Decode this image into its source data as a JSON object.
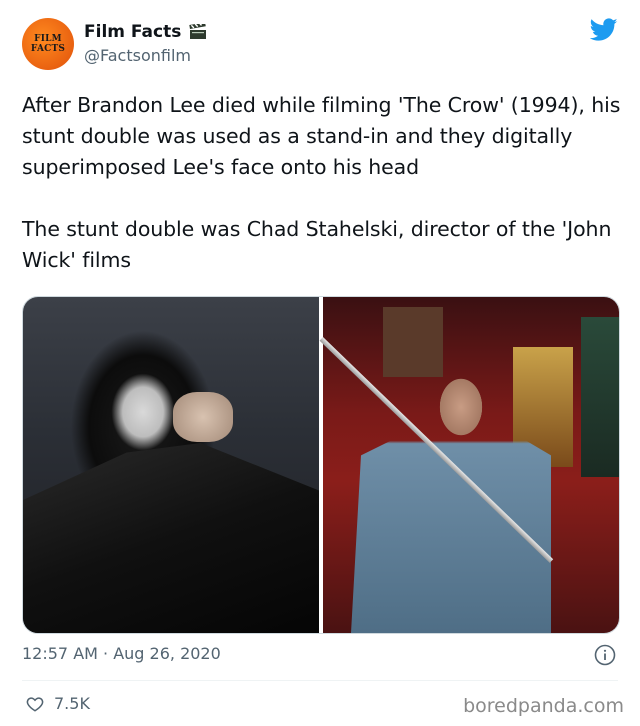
{
  "author": {
    "avatar_text_line1": "FILM",
    "avatar_text_line2": "FACTS",
    "name": "Film Facts",
    "handle": "@Factsonfilm"
  },
  "tweet": {
    "paragraph1": "After Brandon Lee died while filming 'The Crow' (1994), his stunt double was used as a stand-in and they digitally superimposed Lee's face onto his head",
    "paragraph2": "The stunt double was Chad Stahelski, director of the 'John Wick' films"
  },
  "meta": {
    "timestamp": "12:57 AM · Aug 26, 2020",
    "likes": "7.5K"
  },
  "watermark": "boredpanda.com",
  "icons": {
    "brand": "twitter-bird-icon",
    "name_emoji": "clapper-board-icon",
    "info": "info-icon",
    "like": "heart-icon"
  },
  "colors": {
    "twitter_blue": "#1d9bf0",
    "secondary_text": "#536471",
    "primary_text": "#0f1419"
  }
}
